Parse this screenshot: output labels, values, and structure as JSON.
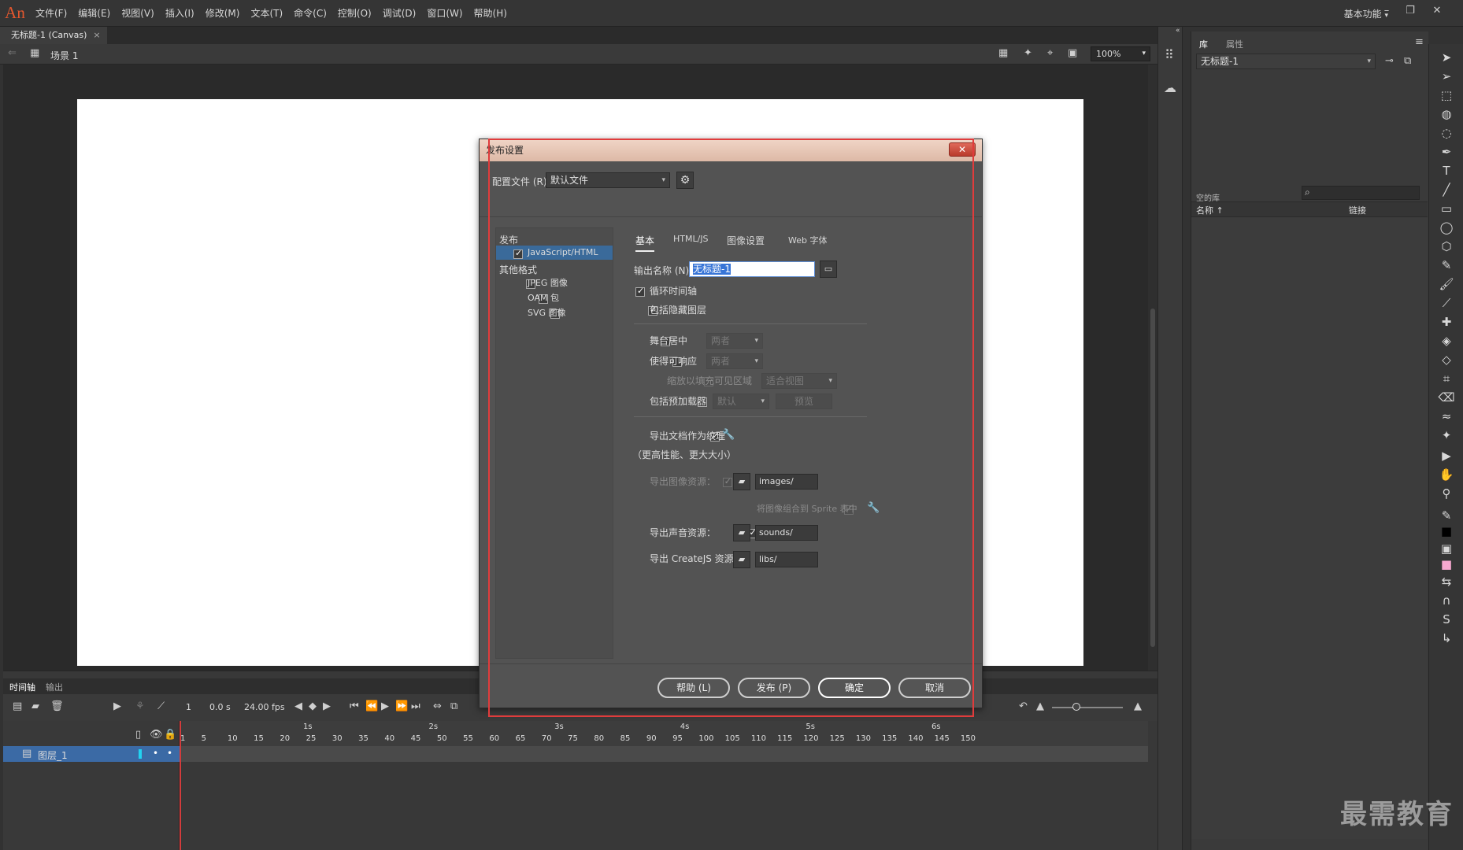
{
  "app": {
    "logo": "An",
    "menu": [
      "文件(F)",
      "编辑(E)",
      "视图(V)",
      "插入(I)",
      "修改(M)",
      "文本(T)",
      "命令(C)",
      "控制(O)",
      "调试(D)",
      "窗口(W)",
      "帮助(H)"
    ],
    "workspace": "基本功能",
    "window_buttons": [
      "–",
      "❐",
      "✕"
    ]
  },
  "document": {
    "tab_label": "无标题-1 (Canvas)",
    "tab_close": "×",
    "scene": "场景 1",
    "zoom": "100%"
  },
  "dialog": {
    "title": "发布设置",
    "close": "✕",
    "profile_label": "配置文件 (R):",
    "profile_value": "默认文件",
    "left": {
      "publish_header": "发布",
      "js_html": {
        "label": "JavaScript/HTML",
        "checked": true
      },
      "other_header": "其他格式",
      "others": [
        {
          "label": "JPEG 图像",
          "checked": false
        },
        {
          "label": "OAM 包",
          "checked": false
        },
        {
          "label": "SVG 图像",
          "checked": false
        }
      ]
    },
    "tabs": [
      "基本",
      "HTML/JS",
      "图像设置",
      "Web 字体"
    ],
    "output_label": "输出名称 (N):",
    "output_value": "无标题-1",
    "loop_timeline": "循环时间轴",
    "include_hidden": "包括隐藏图层",
    "center_stage": "舞台居中",
    "center_stage_value": "两者",
    "responsive": "使得可响应",
    "responsive_value": "两者",
    "scale_fill": "缩放以填充可见区域",
    "scale_fill_value": "适合视图",
    "preloader": "包括预加载器",
    "preloader_value": "默认",
    "preview": "预览",
    "export_texture": "导出文档作为纹理",
    "texture_note": "（更高性能、更大大小）",
    "export_images": "导出图像资源：",
    "images_path": "images/",
    "combine_sprite": "将图像组合到 Sprite 表中",
    "export_sounds": "导出声音资源：",
    "sounds_path": "sounds/",
    "export_createjs": "导出 CreateJS 资源：",
    "libs_path": "libs/",
    "buttons": {
      "help": "帮助 (L)",
      "publish": "发布 (P)",
      "ok": "确定",
      "cancel": "取消"
    }
  },
  "properties": {
    "tab_library": "库",
    "tab_properties": "属性",
    "doc_select": "无标题-1",
    "empty_library": "空的库",
    "col_name": "名称 ↑",
    "col_linkage": "链接"
  },
  "timeline": {
    "tabs": [
      "时间轴",
      "输出"
    ],
    "frame": "1",
    "time": "0.0 s",
    "fps": "24.00 fps",
    "layer_name": "图层_1",
    "seconds": [
      "1s",
      "2s",
      "3s",
      "4s",
      "5s",
      "6s"
    ],
    "frame_ticks": [
      "1",
      "5",
      "10",
      "15",
      "20",
      "25",
      "30",
      "35",
      "40",
      "45",
      "50",
      "55",
      "60",
      "65",
      "70",
      "75",
      "80",
      "85",
      "90",
      "95",
      "100",
      "105",
      "110",
      "115",
      "120",
      "125",
      "130",
      "135",
      "140",
      "145",
      "150"
    ]
  },
  "watermark": "最需教育"
}
